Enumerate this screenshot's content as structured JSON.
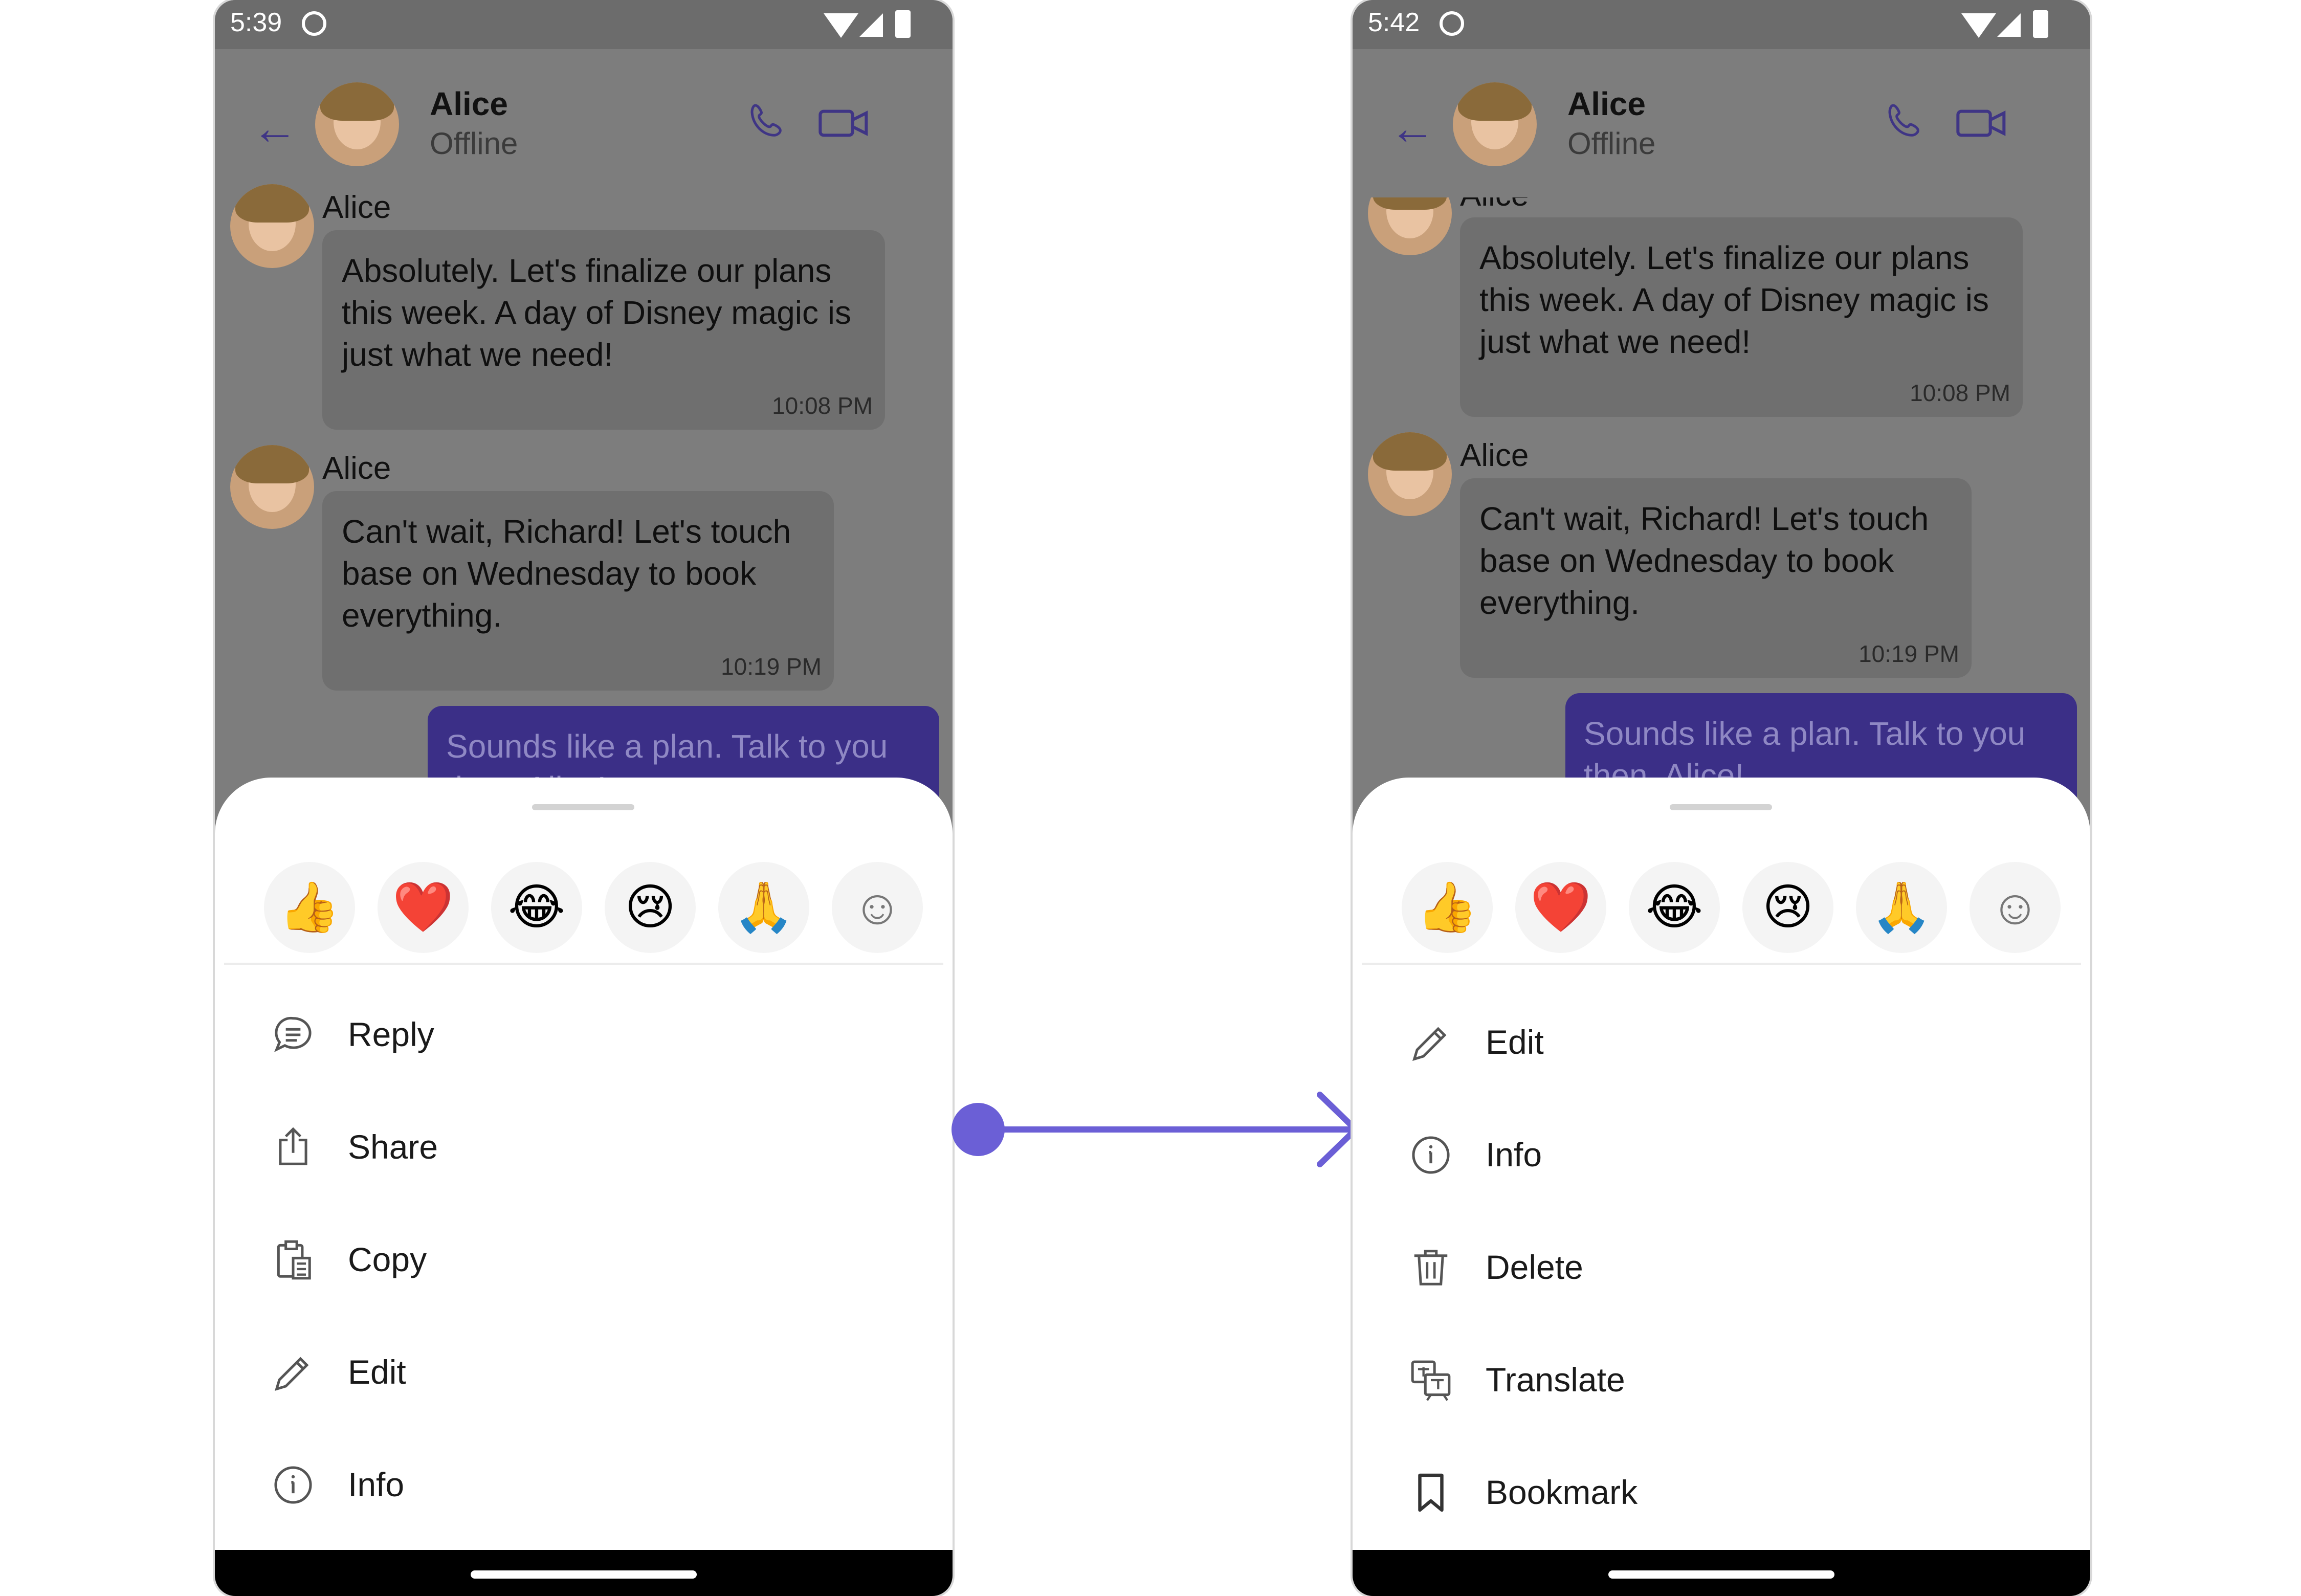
{
  "screens": [
    {
      "status_time": "5:39",
      "header": {
        "name": "Alice",
        "status": "Offline"
      },
      "messages": [
        {
          "sender": "Alice",
          "text": "Absolutely. Let's finalize our plans this week. A day of Disney magic is just what we need!",
          "time": "10:08 PM"
        },
        {
          "sender": "Alice",
          "text": "Can't wait, Richard! Let's touch base on Wednesday to book everything.",
          "time": "10:19 PM"
        }
      ],
      "outgoing": "Sounds like a plan. Talk to you then, Alice!",
      "menu": [
        {
          "label": "Reply",
          "icon": "reply-icon"
        },
        {
          "label": "Share",
          "icon": "share-icon"
        },
        {
          "label": "Copy",
          "icon": "copy-icon"
        },
        {
          "label": "Edit",
          "icon": "edit-icon"
        },
        {
          "label": "Info",
          "icon": "info-icon"
        }
      ]
    },
    {
      "status_time": "5:42",
      "header": {
        "name": "Alice",
        "status": "Offline"
      },
      "messages": [
        {
          "sender": "Alice",
          "text": "Absolutely. Let's finalize our plans this week. A day of Disney magic is just what we need!",
          "time": "10:08 PM"
        },
        {
          "sender": "Alice",
          "text": "Can't wait, Richard! Let's touch base on Wednesday to book everything.",
          "time": "10:19 PM"
        }
      ],
      "outgoing": "Sounds like a plan. Talk to you then, Alice!",
      "menu": [
        {
          "label": "Edit",
          "icon": "edit-icon"
        },
        {
          "label": "Info",
          "icon": "info-icon"
        },
        {
          "label": "Delete",
          "icon": "delete-icon"
        },
        {
          "label": "Translate",
          "icon": "translate-icon"
        },
        {
          "label": "Bookmark",
          "icon": "bookmark-icon"
        }
      ]
    }
  ],
  "reactions": [
    "👍",
    "❤️",
    "😂",
    "😢",
    "🙏"
  ],
  "accent_color": "#6b5fd6"
}
